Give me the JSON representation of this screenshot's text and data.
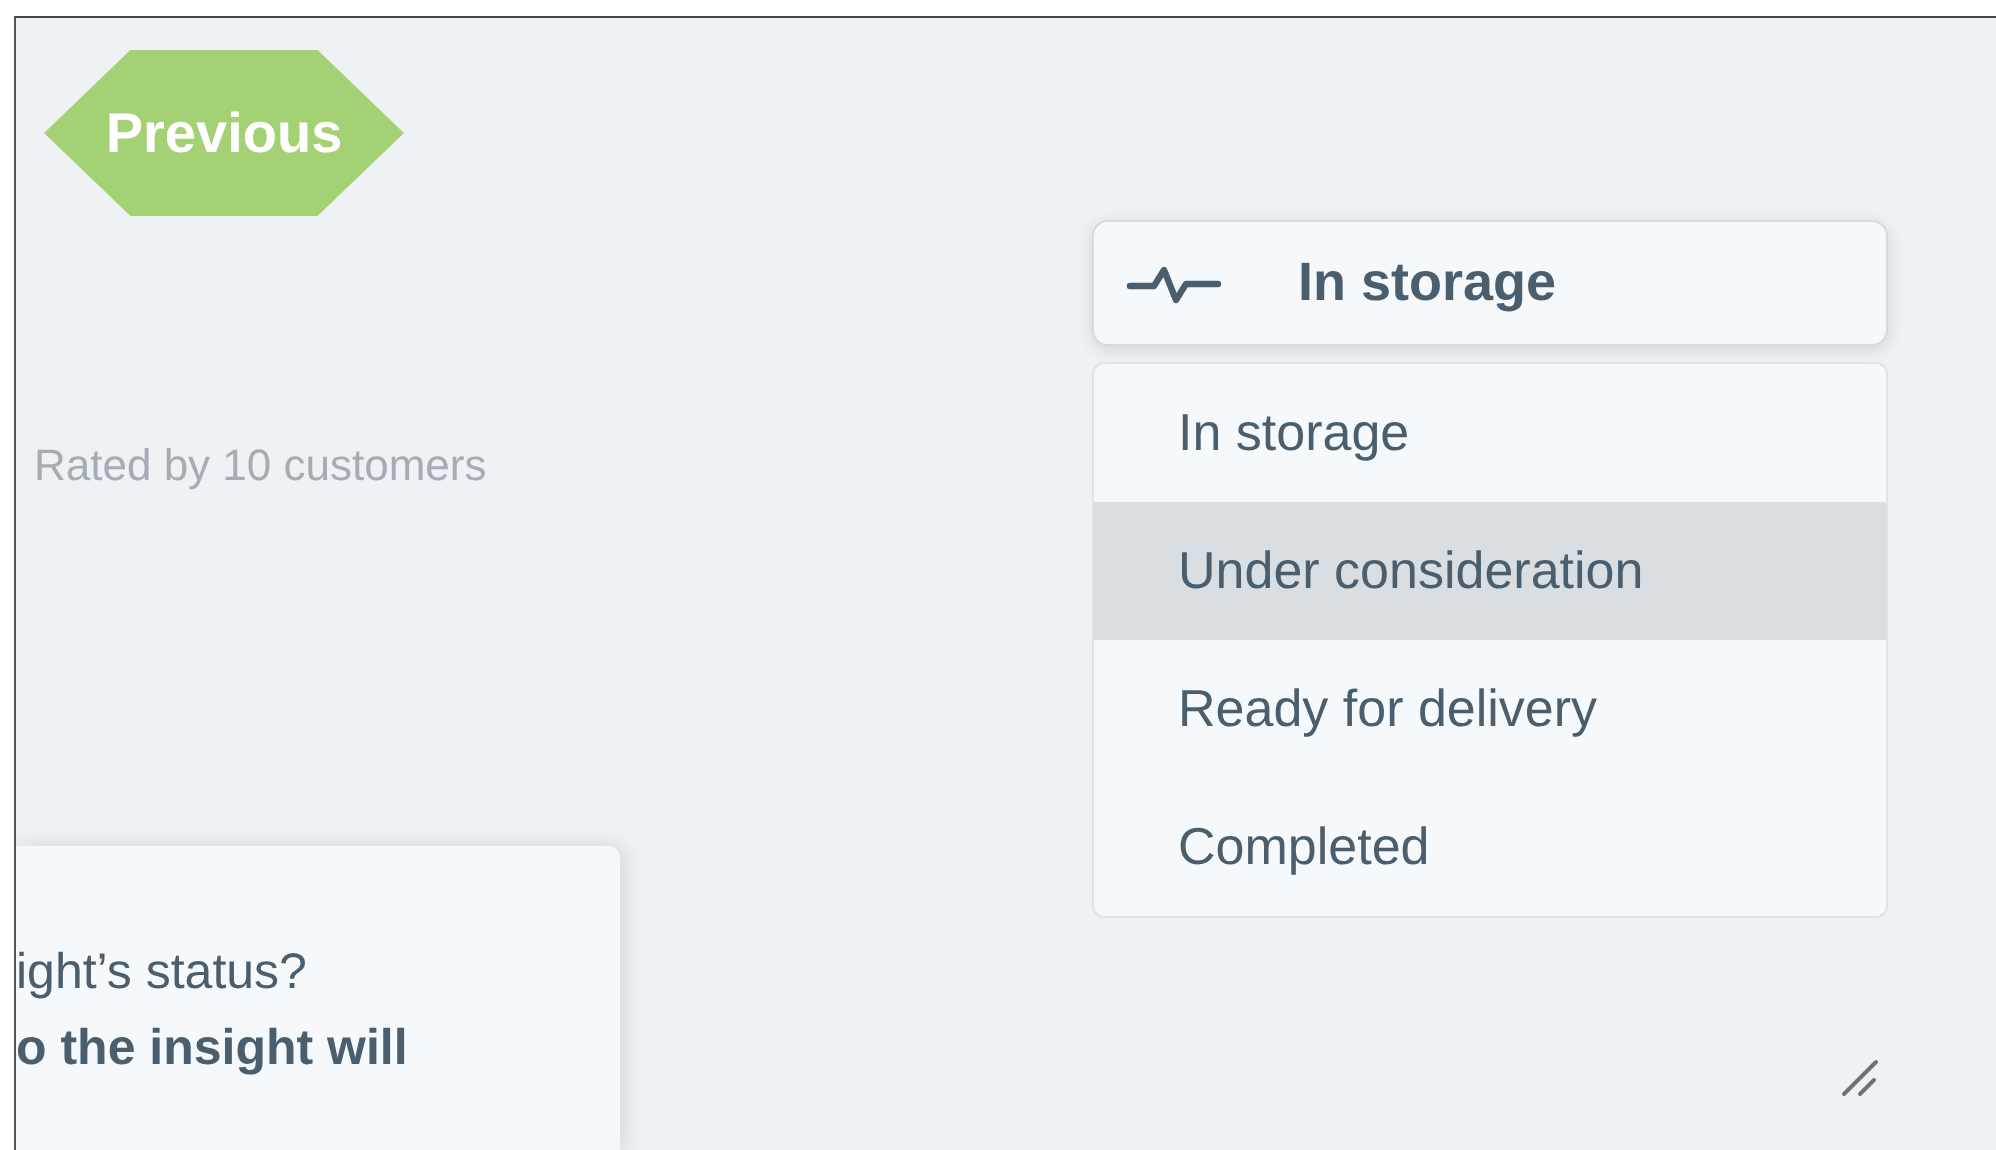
{
  "previous_badge": {
    "label": "Previous"
  },
  "rating_note": "Rated by 10 customers",
  "status_dropdown": {
    "value": "In storage",
    "expanded": true,
    "options": [
      {
        "label": "In storage",
        "highlighted": false
      },
      {
        "label": "Under consideration",
        "highlighted": true
      },
      {
        "label": "Ready for delivery",
        "highlighted": false
      },
      {
        "label": "Completed",
        "highlighted": false
      }
    ]
  },
  "card": {
    "question": "ight’s status?",
    "statement": "o the insight will"
  }
}
